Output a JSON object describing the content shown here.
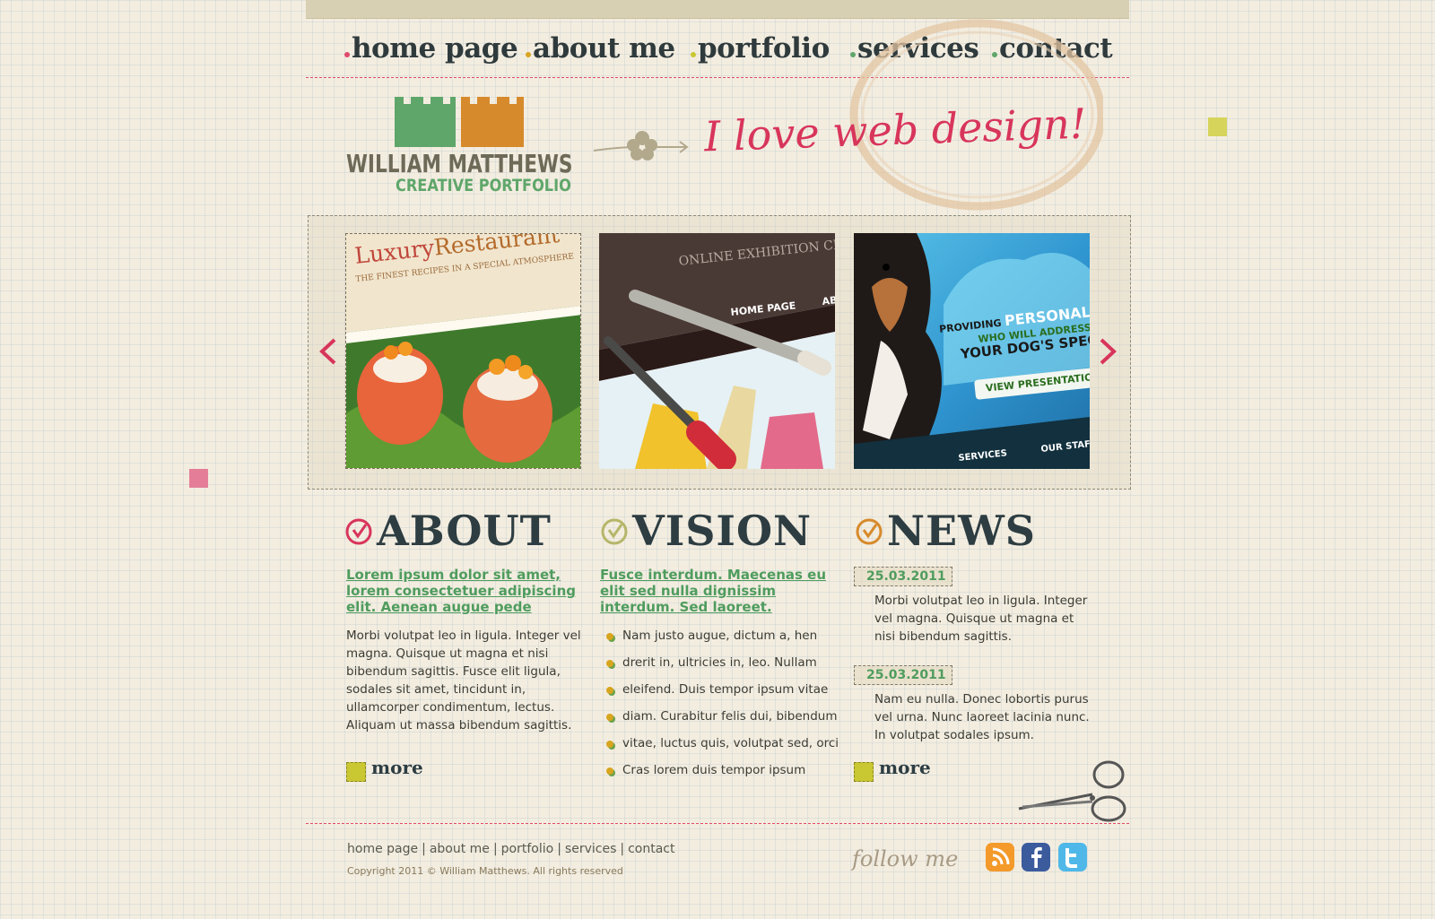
{
  "nav": {
    "items": [
      {
        "label": "home page",
        "dot": "#e04a6a"
      },
      {
        "label": "about me",
        "dot": "#d8a51f"
      },
      {
        "label": "portfolio",
        "dot": "#c9c732"
      },
      {
        "label": "services",
        "dot": "#5fa66a"
      },
      {
        "label": "contact",
        "dot": "#5fa66a"
      }
    ]
  },
  "logo": {
    "name": "WILLIAM MATTHEWS",
    "subtitle": "CREATIVE PORTFOLIO",
    "colors": {
      "green": "#5fa66a",
      "orange": "#d78a2b"
    }
  },
  "slogan": "I love web design!",
  "slider": {
    "thumb1": {
      "title_a": "Luxury",
      "title_b": "Restaurant",
      "tagline": "THE FINEST RECIPES IN A SPECIAL ATMOSPHERE"
    },
    "thumb2": {
      "header": "ONLINE EXHIBITION CE",
      "nav_a": "HOME PAGE",
      "nav_b": "AB"
    },
    "thumb3": {
      "line1": "PROVIDING",
      "line1b": "PERSONAL T",
      "line2": "WHO WILL ADDRESS",
      "line3": "YOUR DOG'S SPECIAL",
      "button": "VIEW PRESENTATION",
      "nav_a": "SERVICES",
      "nav_b": "OUR STAFF"
    }
  },
  "about": {
    "title": "ABOUT",
    "lead": "Lorem ipsum dolor sit amet, lorem consectetuer adipiscing elit. Aenean augue pede",
    "body": "Morbi volutpat leo in ligula. Integer vel magna. Quisque ut magna et nisi bibendum sagittis. Fusce elit ligula, sodales sit amet, tincidunt in, ullamcorper condimentum, lectus. Aliquam ut massa bibendum sagittis.",
    "more": "more"
  },
  "vision": {
    "title": "VISION",
    "lead": "Fusce interdum. Maecenas eu elit sed nulla dignissim interdum. Sed laoreet.",
    "items": [
      "Nam justo augue, dictum a, hen",
      "drerit in, ultricies in, leo. Nullam",
      "eleifend. Duis tempor ipsum vitae",
      "diam. Curabitur felis dui, bibendum",
      "vitae, luctus quis, volutpat sed, orci",
      "Cras lorem duis tempor ipsum"
    ]
  },
  "news": {
    "title": "NEWS",
    "entries": [
      {
        "date": "25.03.2011",
        "text": "Morbi volutpat leo in ligula. Integer vel magna. Quisque ut magna et nisi bibendum sagittis."
      },
      {
        "date": "25.03.2011",
        "text": "Nam eu nulla. Donec lobortis purus vel urna. Nunc laoreet lacinia nunc. In volutpat sodales ipsum."
      }
    ],
    "more": "more"
  },
  "footer": {
    "links": [
      "home page",
      "about me",
      "portfolio",
      "services",
      "contact"
    ],
    "copyright": "Copyright 2011 © William Matthews. All rights reserved",
    "follow": "follow me",
    "social": [
      "rss-icon",
      "facebook-icon",
      "twitter-icon"
    ]
  }
}
